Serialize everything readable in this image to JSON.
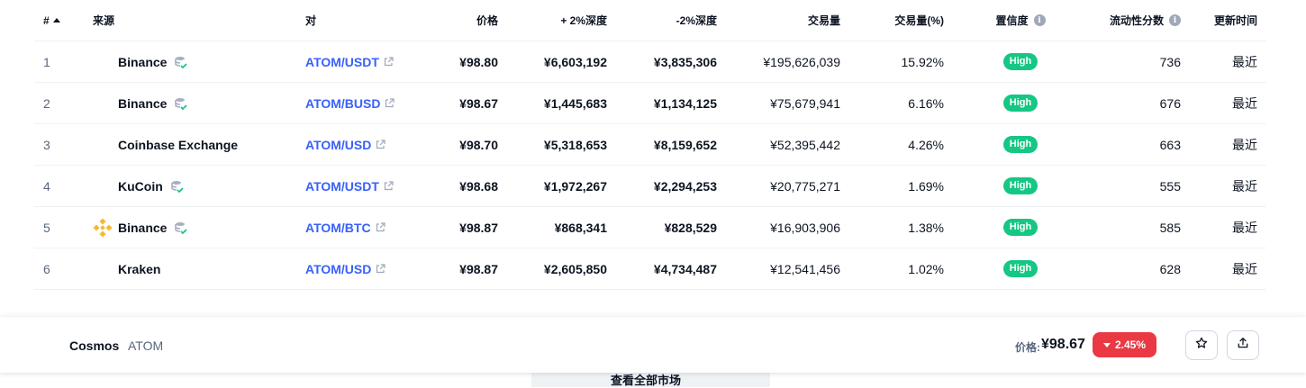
{
  "header": {
    "num": "#",
    "source": "来源",
    "pair": "对",
    "price": "价格",
    "plus_depth": "+ 2%深度",
    "minus_depth": "-2%深度",
    "volume": "交易量",
    "volume_pct": "交易量(%)",
    "confidence": "置信度",
    "liquidity": "流动性分数",
    "updated": "更新时间"
  },
  "rows": [
    {
      "num": "1",
      "source": "Binance",
      "pair": "ATOM/USDT",
      "price": "¥98.80",
      "plus": "¥6,603,192",
      "minus": "¥3,835,306",
      "volume": "¥195,626,039",
      "volume_pct": "15.92%",
      "confidence": "High",
      "liquidity": "736",
      "updated": "最近"
    },
    {
      "num": "2",
      "source": "Binance",
      "pair": "ATOM/BUSD",
      "price": "¥98.67",
      "plus": "¥1,445,683",
      "minus": "¥1,134,125",
      "volume": "¥75,679,941",
      "volume_pct": "6.16%",
      "confidence": "High",
      "liquidity": "676",
      "updated": "最近"
    },
    {
      "num": "3",
      "source": "Coinbase Exchange",
      "pair": "ATOM/USD",
      "price": "¥98.70",
      "plus": "¥5,318,653",
      "minus": "¥8,159,652",
      "volume": "¥52,395,442",
      "volume_pct": "4.26%",
      "confidence": "High",
      "liquidity": "663",
      "updated": "最近"
    },
    {
      "num": "4",
      "source": "KuCoin",
      "pair": "ATOM/USDT",
      "price": "¥98.68",
      "plus": "¥1,972,267",
      "minus": "¥2,294,253",
      "volume": "¥20,775,271",
      "volume_pct": "1.69%",
      "confidence": "High",
      "liquidity": "555",
      "updated": "最近"
    },
    {
      "num": "5",
      "source": "Binance",
      "pair": "ATOM/BTC",
      "price": "¥98.87",
      "plus": "¥868,341",
      "minus": "¥828,529",
      "volume": "¥16,903,906",
      "volume_pct": "1.38%",
      "confidence": "High",
      "liquidity": "585",
      "updated": "最近"
    },
    {
      "num": "6",
      "source": "Kraken",
      "pair": "ATOM/USD",
      "price": "¥98.87",
      "plus": "¥2,605,850",
      "minus": "¥4,734,487",
      "volume": "¥12,541,456",
      "volume_pct": "1.02%",
      "confidence": "High",
      "liquidity": "628",
      "updated": "最近"
    }
  ],
  "footer_button": "查看全部市场",
  "sticky": {
    "coin_name": "Cosmos",
    "coin_symbol": "ATOM",
    "price_label": "价格:",
    "price_value": "¥98.67",
    "change": "2.45%"
  },
  "colors": {
    "link_blue": "#3861fb",
    "high_green": "#16c784",
    "down_red": "#ea3943",
    "binance_yellow": "#f3ba2f"
  },
  "icons": [
    "sort-up-icon",
    "info-icon",
    "verified-icon",
    "external-link-icon",
    "binance-logo",
    "caret-down-icon",
    "star-icon",
    "share-icon"
  ]
}
